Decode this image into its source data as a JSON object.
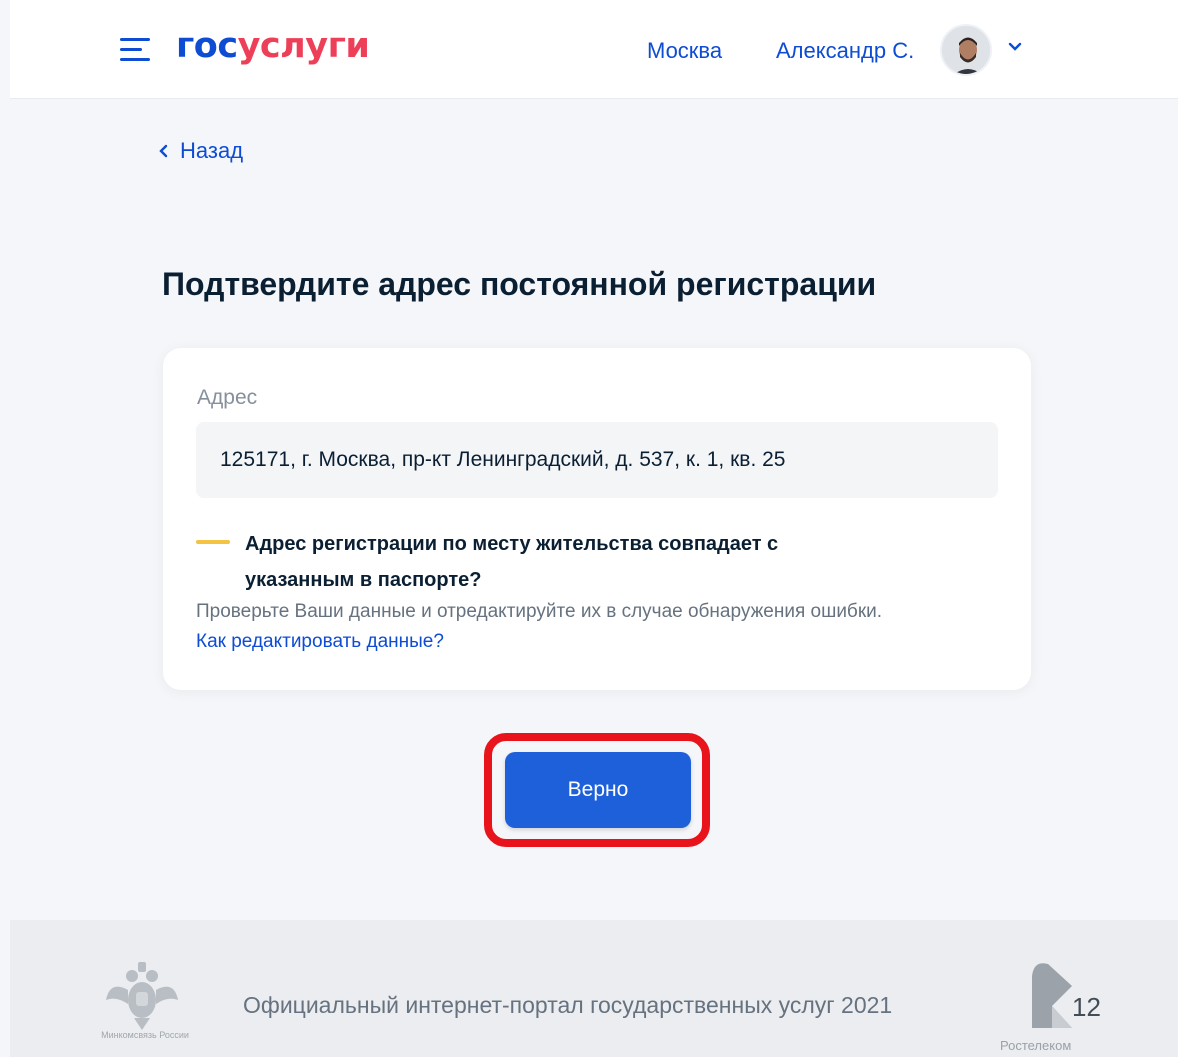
{
  "header": {
    "logo_part1": "гос",
    "logo_part2": "услуги",
    "city": "Москва",
    "user_name": "Александр С."
  },
  "navigation": {
    "back_label": "Назад"
  },
  "main": {
    "title": "Подтвердите адрес постоянной регистрации",
    "card": {
      "field_label": "Адрес",
      "field_value": "125171, г. Москва, пр-кт Ленинградский, д. 537, к. 1, кв. 25",
      "question": "Адрес регистрации по месту жительства совпадает с указанным в паспорте?",
      "hint": "Проверьте Ваши данные и отредактируйте их в случае обнаружения ошибки.",
      "edit_link": "Как редактировать данные?"
    },
    "confirm_button": "Верно"
  },
  "footer": {
    "ministry_caption": "Минкомсвязь России",
    "text": "Официальный интернет-портал государственных услуг 2021",
    "partner_caption": "Ростелеком"
  },
  "slide_number": "12",
  "colors": {
    "brand_blue": "#0d4cd3",
    "brand_red": "#ee3f58",
    "button_blue": "#1e60d9",
    "highlight_red": "#e8131b",
    "warning_yellow": "#f5c343"
  }
}
